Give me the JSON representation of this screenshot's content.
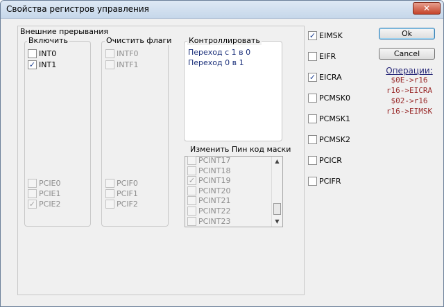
{
  "window": {
    "title": "Свойства регистров управления",
    "close_glyph": "✕"
  },
  "main_group": {
    "label": "Внешние прерывания"
  },
  "enable_group": {
    "label": "Включить",
    "top_items": [
      {
        "label": "INT0",
        "checked": false,
        "enabled": true
      },
      {
        "label": "INT1",
        "checked": true,
        "enabled": true
      }
    ],
    "bottom_items": [
      {
        "label": "PCIE0",
        "checked": false,
        "enabled": false
      },
      {
        "label": "PCIE1",
        "checked": false,
        "enabled": false
      },
      {
        "label": "PCIE2",
        "checked": true,
        "enabled": false
      }
    ]
  },
  "clear_group": {
    "label": "Очистить флаги",
    "top_items": [
      {
        "label": "INTF0",
        "checked": false,
        "enabled": false
      },
      {
        "label": "INTF1",
        "checked": false,
        "enabled": false
      }
    ],
    "bottom_items": [
      {
        "label": "PCIF0",
        "checked": false,
        "enabled": false
      },
      {
        "label": "PCIF1",
        "checked": false,
        "enabled": false
      },
      {
        "label": "PCIF2",
        "checked": false,
        "enabled": false
      }
    ]
  },
  "control_group": {
    "label": "Контроллировать",
    "items": [
      "Переход с 1 в 0",
      "Переход 0 в 1"
    ]
  },
  "pin_mask_group": {
    "label": "Изменить Пин код маски",
    "items": [
      {
        "label": "PCINT17",
        "checked": false
      },
      {
        "label": "PCINT18",
        "checked": false
      },
      {
        "label": "PCINT19",
        "checked": true
      },
      {
        "label": "PCINT20",
        "checked": false
      },
      {
        "label": "PCINT21",
        "checked": false
      },
      {
        "label": "PCINT22",
        "checked": false
      },
      {
        "label": "PCINT23",
        "checked": false
      }
    ]
  },
  "registers": [
    {
      "label": "EIMSK",
      "checked": true
    },
    {
      "label": "EIFR",
      "checked": false
    },
    {
      "label": "EICRA",
      "checked": true
    },
    {
      "label": "PCMSK0",
      "checked": false
    },
    {
      "label": "PCMSK1",
      "checked": false
    },
    {
      "label": "PCMSK2",
      "checked": false
    },
    {
      "label": "PCICR",
      "checked": false
    },
    {
      "label": "PCIFR",
      "checked": false
    }
  ],
  "buttons": {
    "ok": "Ok",
    "cancel": "Cancel"
  },
  "operations": {
    "title": "Операции:",
    "lines": [
      "$0E->r16",
      "r16->EICRA",
      "$02->r16",
      "r16->EIMSK"
    ]
  },
  "check_glyph": "✓"
}
